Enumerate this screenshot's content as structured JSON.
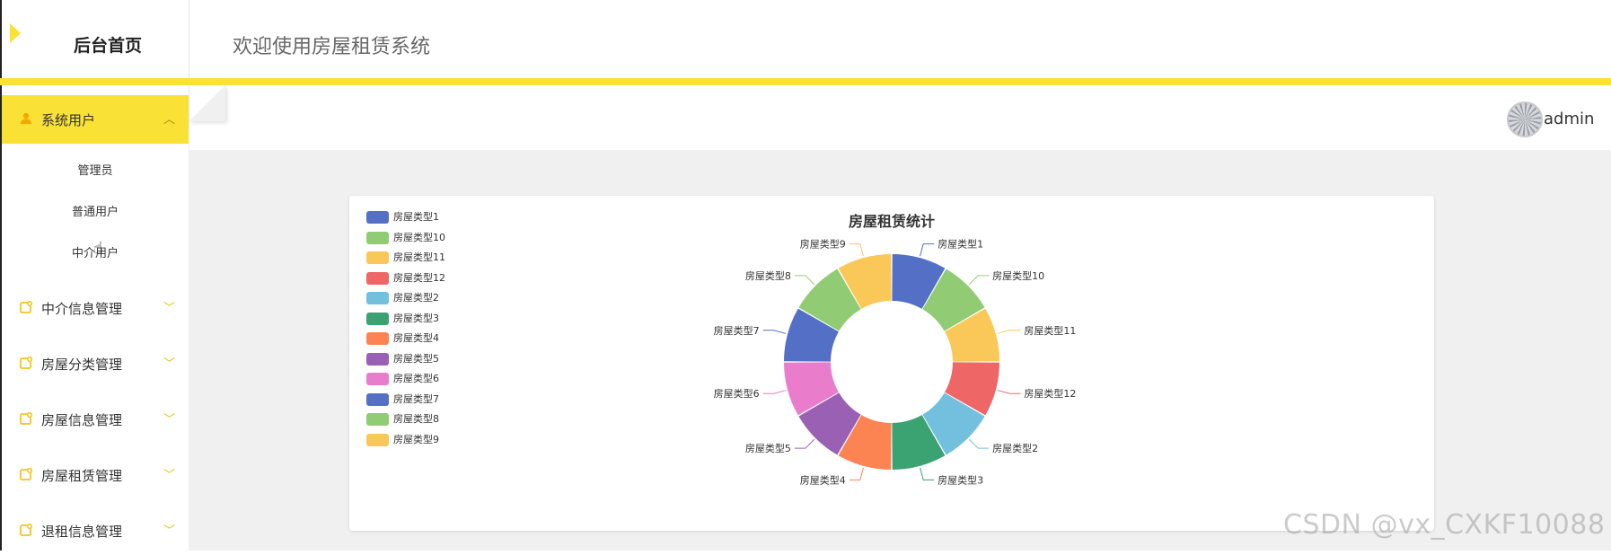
{
  "brand": {
    "title": "后台首页"
  },
  "header": {
    "welcome": "欢迎使用房屋租赁系统",
    "username": "admin"
  },
  "sidebar": {
    "items": [
      {
        "label": "系统用户",
        "expanded": true,
        "children": [
          "管理员",
          "普通用户",
          "中介用户"
        ]
      },
      {
        "label": "中介信息管理"
      },
      {
        "label": "房屋分类管理"
      },
      {
        "label": "房屋信息管理"
      },
      {
        "label": "房屋租赁管理"
      },
      {
        "label": "退租信息管理"
      }
    ]
  },
  "colors": {
    "accent": "#f9e135",
    "menu_icon": "#f5c41a"
  },
  "watermark": "CSDN @vx_CXKF10088",
  "chart_data": {
    "type": "pie",
    "donut": true,
    "title": "房屋租赁统计",
    "legend_position": "top-left",
    "series": [
      {
        "name": "",
        "data": [
          {
            "name": "房屋类型1",
            "value": 1,
            "color": "#5470c6"
          },
          {
            "name": "房屋类型10",
            "value": 1,
            "color": "#91cc75"
          },
          {
            "name": "房屋类型11",
            "value": 1,
            "color": "#fac858"
          },
          {
            "name": "房屋类型12",
            "value": 1,
            "color": "#ee6666"
          },
          {
            "name": "房屋类型2",
            "value": 1,
            "color": "#73c0de"
          },
          {
            "name": "房屋类型3",
            "value": 1,
            "color": "#3ba272"
          },
          {
            "name": "房屋类型4",
            "value": 1,
            "color": "#fc8452"
          },
          {
            "name": "房屋类型5",
            "value": 1,
            "color": "#9a60b4"
          },
          {
            "name": "房屋类型6",
            "value": 1,
            "color": "#ea7ccc"
          },
          {
            "name": "房屋类型7",
            "value": 1,
            "color": "#5470c6"
          },
          {
            "name": "房屋类型8",
            "value": 1,
            "color": "#91cc75"
          },
          {
            "name": "房屋类型9",
            "value": 1,
            "color": "#fac858"
          }
        ]
      }
    ]
  }
}
